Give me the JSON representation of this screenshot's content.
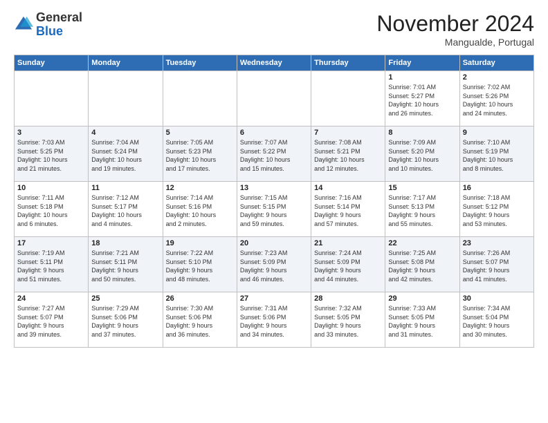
{
  "header": {
    "logo_general": "General",
    "logo_blue": "Blue",
    "month": "November 2024",
    "location": "Mangualde, Portugal"
  },
  "weekdays": [
    "Sunday",
    "Monday",
    "Tuesday",
    "Wednesday",
    "Thursday",
    "Friday",
    "Saturday"
  ],
  "weeks": [
    [
      {
        "day": "",
        "info": ""
      },
      {
        "day": "",
        "info": ""
      },
      {
        "day": "",
        "info": ""
      },
      {
        "day": "",
        "info": ""
      },
      {
        "day": "",
        "info": ""
      },
      {
        "day": "1",
        "info": "Sunrise: 7:01 AM\nSunset: 5:27 PM\nDaylight: 10 hours\nand 26 minutes."
      },
      {
        "day": "2",
        "info": "Sunrise: 7:02 AM\nSunset: 5:26 PM\nDaylight: 10 hours\nand 24 minutes."
      }
    ],
    [
      {
        "day": "3",
        "info": "Sunrise: 7:03 AM\nSunset: 5:25 PM\nDaylight: 10 hours\nand 21 minutes."
      },
      {
        "day": "4",
        "info": "Sunrise: 7:04 AM\nSunset: 5:24 PM\nDaylight: 10 hours\nand 19 minutes."
      },
      {
        "day": "5",
        "info": "Sunrise: 7:05 AM\nSunset: 5:23 PM\nDaylight: 10 hours\nand 17 minutes."
      },
      {
        "day": "6",
        "info": "Sunrise: 7:07 AM\nSunset: 5:22 PM\nDaylight: 10 hours\nand 15 minutes."
      },
      {
        "day": "7",
        "info": "Sunrise: 7:08 AM\nSunset: 5:21 PM\nDaylight: 10 hours\nand 12 minutes."
      },
      {
        "day": "8",
        "info": "Sunrise: 7:09 AM\nSunset: 5:20 PM\nDaylight: 10 hours\nand 10 minutes."
      },
      {
        "day": "9",
        "info": "Sunrise: 7:10 AM\nSunset: 5:19 PM\nDaylight: 10 hours\nand 8 minutes."
      }
    ],
    [
      {
        "day": "10",
        "info": "Sunrise: 7:11 AM\nSunset: 5:18 PM\nDaylight: 10 hours\nand 6 minutes."
      },
      {
        "day": "11",
        "info": "Sunrise: 7:12 AM\nSunset: 5:17 PM\nDaylight: 10 hours\nand 4 minutes."
      },
      {
        "day": "12",
        "info": "Sunrise: 7:14 AM\nSunset: 5:16 PM\nDaylight: 10 hours\nand 2 minutes."
      },
      {
        "day": "13",
        "info": "Sunrise: 7:15 AM\nSunset: 5:15 PM\nDaylight: 9 hours\nand 59 minutes."
      },
      {
        "day": "14",
        "info": "Sunrise: 7:16 AM\nSunset: 5:14 PM\nDaylight: 9 hours\nand 57 minutes."
      },
      {
        "day": "15",
        "info": "Sunrise: 7:17 AM\nSunset: 5:13 PM\nDaylight: 9 hours\nand 55 minutes."
      },
      {
        "day": "16",
        "info": "Sunrise: 7:18 AM\nSunset: 5:12 PM\nDaylight: 9 hours\nand 53 minutes."
      }
    ],
    [
      {
        "day": "17",
        "info": "Sunrise: 7:19 AM\nSunset: 5:11 PM\nDaylight: 9 hours\nand 51 minutes."
      },
      {
        "day": "18",
        "info": "Sunrise: 7:21 AM\nSunset: 5:11 PM\nDaylight: 9 hours\nand 50 minutes."
      },
      {
        "day": "19",
        "info": "Sunrise: 7:22 AM\nSunset: 5:10 PM\nDaylight: 9 hours\nand 48 minutes."
      },
      {
        "day": "20",
        "info": "Sunrise: 7:23 AM\nSunset: 5:09 PM\nDaylight: 9 hours\nand 46 minutes."
      },
      {
        "day": "21",
        "info": "Sunrise: 7:24 AM\nSunset: 5:09 PM\nDaylight: 9 hours\nand 44 minutes."
      },
      {
        "day": "22",
        "info": "Sunrise: 7:25 AM\nSunset: 5:08 PM\nDaylight: 9 hours\nand 42 minutes."
      },
      {
        "day": "23",
        "info": "Sunrise: 7:26 AM\nSunset: 5:07 PM\nDaylight: 9 hours\nand 41 minutes."
      }
    ],
    [
      {
        "day": "24",
        "info": "Sunrise: 7:27 AM\nSunset: 5:07 PM\nDaylight: 9 hours\nand 39 minutes."
      },
      {
        "day": "25",
        "info": "Sunrise: 7:29 AM\nSunset: 5:06 PM\nDaylight: 9 hours\nand 37 minutes."
      },
      {
        "day": "26",
        "info": "Sunrise: 7:30 AM\nSunset: 5:06 PM\nDaylight: 9 hours\nand 36 minutes."
      },
      {
        "day": "27",
        "info": "Sunrise: 7:31 AM\nSunset: 5:06 PM\nDaylight: 9 hours\nand 34 minutes."
      },
      {
        "day": "28",
        "info": "Sunrise: 7:32 AM\nSunset: 5:05 PM\nDaylight: 9 hours\nand 33 minutes."
      },
      {
        "day": "29",
        "info": "Sunrise: 7:33 AM\nSunset: 5:05 PM\nDaylight: 9 hours\nand 31 minutes."
      },
      {
        "day": "30",
        "info": "Sunrise: 7:34 AM\nSunset: 5:04 PM\nDaylight: 9 hours\nand 30 minutes."
      }
    ]
  ]
}
